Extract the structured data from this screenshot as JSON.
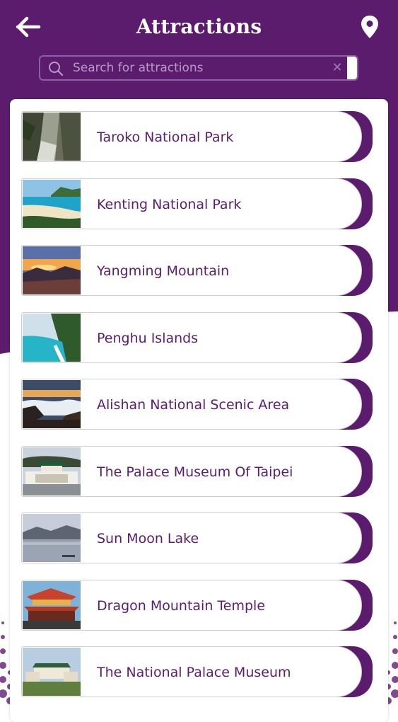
{
  "header": {
    "title": "Attractions",
    "back_icon": "arrow-left-icon",
    "map_icon": "map-pin-icon"
  },
  "search": {
    "placeholder": "Search for attractions",
    "value": "",
    "search_icon": "magnifier-icon",
    "clear_icon": "clear-x-icon",
    "clear_glyph": "✕"
  },
  "colors": {
    "brand_purple": "#5b1c6e",
    "label_purple": "#5b1c6e",
    "background": "#ffffff"
  },
  "attractions": [
    {
      "name": "Taroko National Park",
      "image": "gorge-cliffs"
    },
    {
      "name": "Kenting National Park",
      "image": "beach-coast"
    },
    {
      "name": "Yangming Mountain",
      "image": "mountain-sunset"
    },
    {
      "name": "Penghu Islands",
      "image": "sea-cliff-coast"
    },
    {
      "name": "Alishan National Scenic Area",
      "image": "sea-of-clouds"
    },
    {
      "name": "The Palace Museum Of Taipei",
      "image": "palace-museum-gate"
    },
    {
      "name": "Sun Moon Lake",
      "image": "misty-lake"
    },
    {
      "name": "Dragon Mountain Temple",
      "image": "temple-roof"
    },
    {
      "name": "The National Palace Museum",
      "image": "palace-museum-building"
    }
  ]
}
